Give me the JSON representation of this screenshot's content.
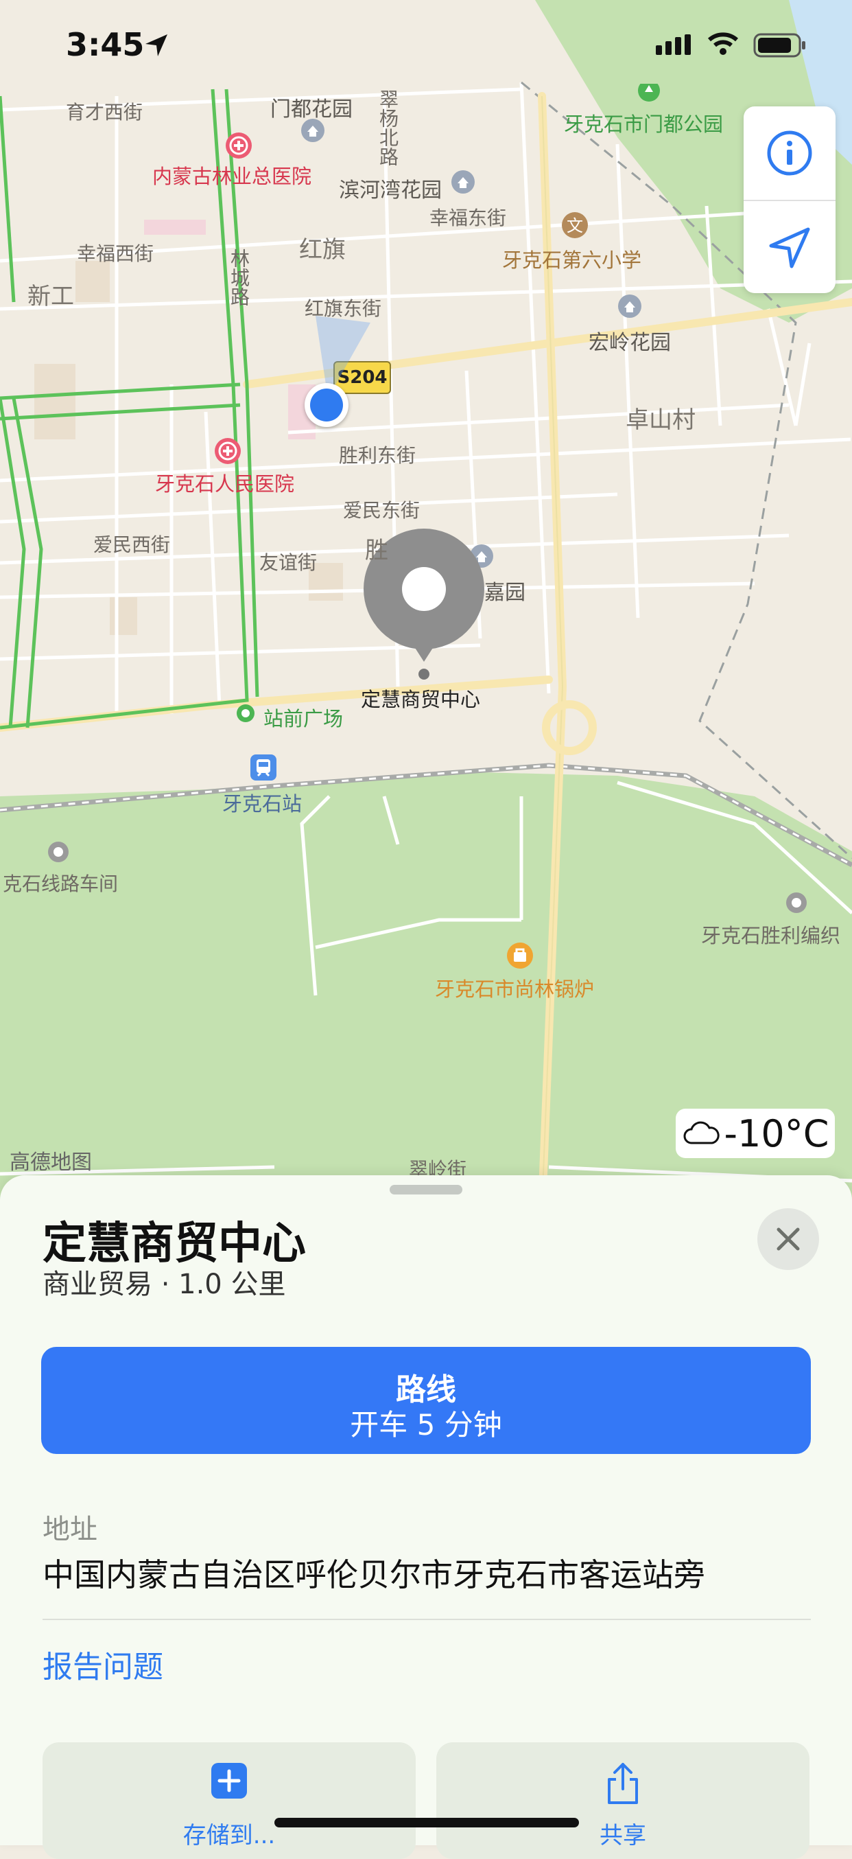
{
  "status_bar": {
    "time": "3:45"
  },
  "map": {
    "labels": {
      "yucai_west": "育才西街",
      "mendu_garden": "门都花园",
      "cuiyang_north": "翠杨北路",
      "park": "牙克石市门都公园",
      "forestry_hospital": "内蒙古林业总医院",
      "binhewan": "滨河湾花园",
      "xingfu_east": "幸福东街",
      "sixth_school": "牙克石第六小学",
      "xingfu_west": "幸福西街",
      "hongqi": "红旗",
      "xingong": "新工",
      "linchenglu": "林城路",
      "hongqi_east": "红旗东街",
      "hongling": "宏岭花园",
      "road_badge": "S204",
      "zhuoshan": "卓山村",
      "peoples_hospital": "牙克石人民医院",
      "shengli_east": "胜利东街",
      "aimin_east": "爱民东街",
      "aimin_west": "爱民西街",
      "youyi": "友谊街",
      "sheng": "胜",
      "jiayuan": "嘉园",
      "pin_name": "定慧商贸中心",
      "station_square": "站前广场",
      "station": "牙克石站",
      "depot": "克石线路车间",
      "shengli_weave": "牙克石胜利编织",
      "boiler": "牙克石市尚林锅炉",
      "gaode": "高德地图",
      "cuiling": "翠岭街"
    },
    "weather": {
      "temp": "-10°C"
    }
  },
  "sheet": {
    "title": "定慧商贸中心",
    "subtitle": "商业贸易 · 1.0 公里",
    "route": {
      "label": "路线",
      "detail": "开车 5 分钟"
    },
    "address_label": "地址",
    "address": "中国内蒙古自治区呼伦贝尔市牙克石市客运站旁",
    "report": "报告问题",
    "actions": [
      {
        "label": "存储到..."
      },
      {
        "label": "共享"
      }
    ]
  },
  "colors": {
    "accent": "#3478f6",
    "park": "#c4e1b0",
    "land": "#f1ece2",
    "bus_route": "#5cc25a"
  }
}
